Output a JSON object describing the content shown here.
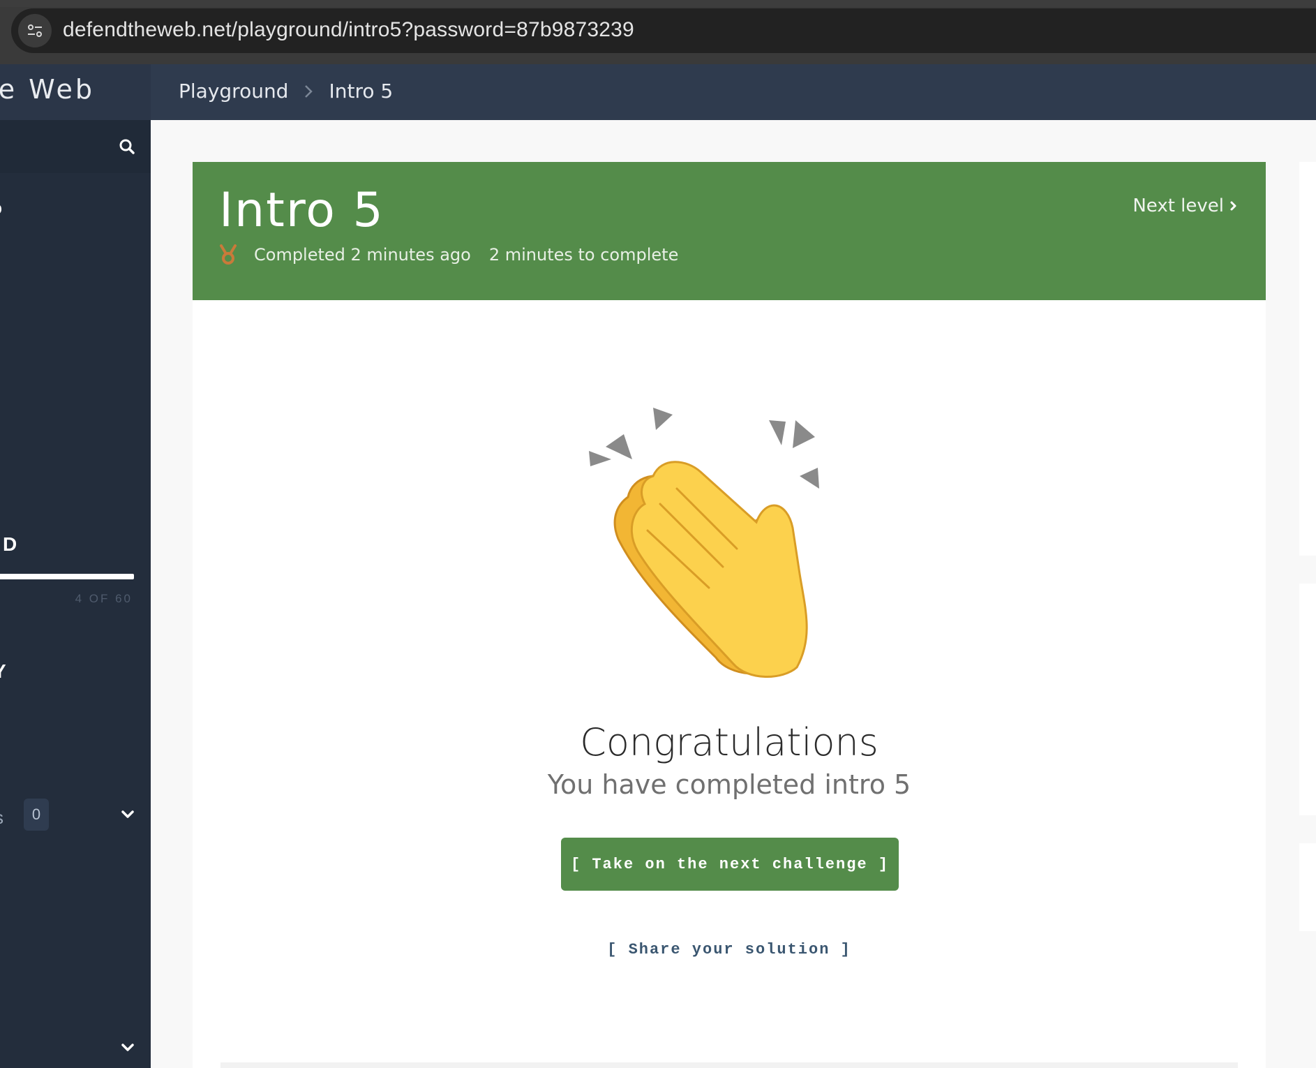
{
  "browser": {
    "url": "defendtheweb.net/playground/intro5?password=87b9873239"
  },
  "sidebar": {
    "brand": "Defend the Web",
    "fragment_1": "o",
    "fragment_2": "D",
    "fragment_3": "Y",
    "fragment_4": "s",
    "progress": {
      "done": 4,
      "total": 60,
      "caption": "4 OF 60"
    },
    "badge_count": "0"
  },
  "header": {
    "breadcrumb": [
      "Playground",
      "Intro 5"
    ]
  },
  "level": {
    "title": "Intro 5",
    "completed_text": "Completed 2 minutes ago",
    "duration_text": "2 minutes to complete",
    "next_level_label": "Next level",
    "congrats_title": "Congratulations",
    "congrats_subtitle": "You have completed intro 5",
    "next_challenge_button": "[ Take on the next challenge ]",
    "share_link": "[ Share your solution ]"
  },
  "colors": {
    "accent_green": "#548c4a",
    "sidebar_bg": "#232d3c",
    "header_bg": "#2f3b4e",
    "medal": "#c97a3a"
  },
  "icons": [
    "site-info-icon",
    "search-icon",
    "chevron-right-icon",
    "medal-icon",
    "clapping-hands-icon",
    "chevron-down-icon"
  ]
}
